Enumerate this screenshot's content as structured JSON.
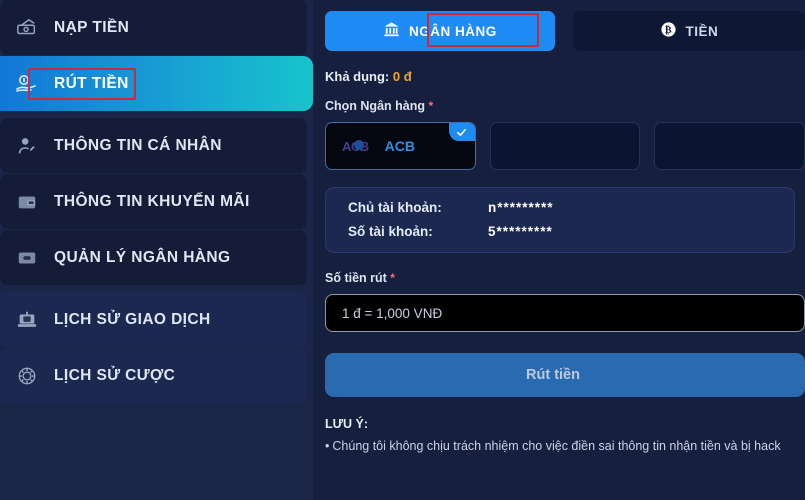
{
  "sidebar": {
    "items": [
      {
        "label": "NẠP TIỀN",
        "icon": "deposit-icon",
        "active": false
      },
      {
        "label": "RÚT TIỀN",
        "icon": "withdraw-hand-icon",
        "active": true
      },
      {
        "label": "THÔNG TIN CÁ NHÂN",
        "icon": "user-profile-icon",
        "active": false
      },
      {
        "label": "THÔNG TIN KHUYẾN MÃI",
        "icon": "wallet-icon",
        "active": false
      },
      {
        "label": "QUẢN LÝ NGÂN HÀNG",
        "icon": "bank-card-icon",
        "active": false
      },
      {
        "label": "LỊCH SỬ GIAO DỊCH",
        "icon": "transaction-log-icon",
        "active": false
      },
      {
        "label": "LỊCH SỬ CƯỢC",
        "icon": "bet-history-icon",
        "active": false
      }
    ]
  },
  "tabs": [
    {
      "label": "NGÂN HÀNG",
      "icon": "bank-building-icon",
      "active": true
    },
    {
      "label": "TIỀN",
      "icon": "bitcoin-icon",
      "active": false
    }
  ],
  "main": {
    "available_label": "Khả dụng:",
    "available_amount": "0 đ",
    "bank_select_label": "Chọn Ngân hàng",
    "required_mark": "*",
    "banks": [
      {
        "code": "ACB",
        "name": "ACB",
        "selected": true
      },
      {
        "code": "",
        "name": "",
        "selected": false
      },
      {
        "code": "",
        "name": "",
        "selected": false
      }
    ],
    "account": {
      "holder_label": "Chủ tài khoản:",
      "holder_value": "n*********",
      "number_label": "Số tài khoản:",
      "number_value": "5*********"
    },
    "amount_label": "Số tiền rút",
    "amount_placeholder": "1 đ = 1,000 VNĐ",
    "submit_label": "Rút tiền",
    "note_title": "LƯU Ý:",
    "note_lines": [
      "Chúng tôi không chịu trách nhiệm cho việc điền sai thông tin nhận tiền và bị hack"
    ]
  },
  "colors": {
    "accent_blue": "#1f8bf5",
    "gradient_start": "#1177d8",
    "gradient_end": "#18c4cc",
    "highlight_red": "#c62b3f",
    "amount_gold": "#f0a828",
    "required_pink": "#ff6b81",
    "panel_navy": "#1d2851",
    "main_bg": "#161f3d"
  }
}
